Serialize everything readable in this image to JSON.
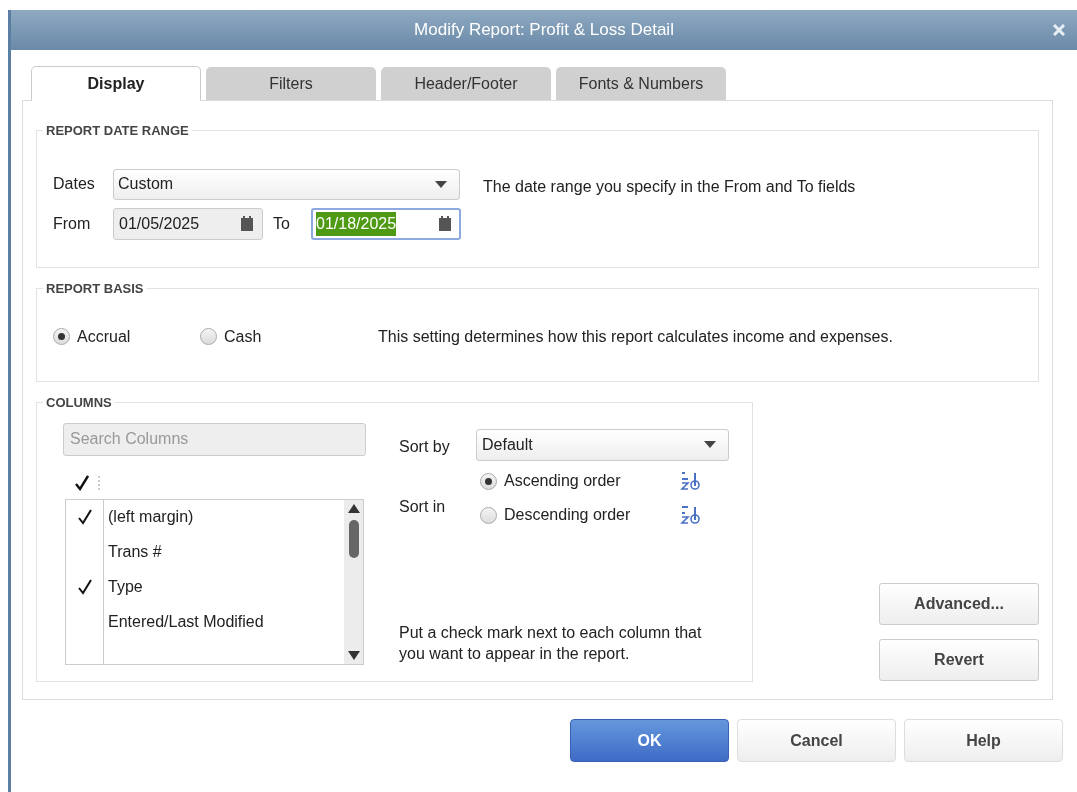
{
  "window": {
    "title": "Modify Report: Profit & Loss Detail"
  },
  "tabs": [
    {
      "label": "Display",
      "selected": true
    },
    {
      "label": "Filters",
      "selected": false
    },
    {
      "label": "Header/Footer",
      "selected": false
    },
    {
      "label": "Fonts & Numbers",
      "selected": false
    }
  ],
  "date_range": {
    "section_title": "REPORT DATE RANGE",
    "dates_label": "Dates",
    "dates_value": "Custom",
    "from_label": "From",
    "from_value": "01/05/2025",
    "to_label": "To",
    "to_value": "01/18/2025",
    "to_text_selected": true,
    "description": "The date range you specify in the From and To fields"
  },
  "report_basis": {
    "section_title": "REPORT BASIS",
    "options": [
      {
        "label": "Accrual",
        "selected": true
      },
      {
        "label": "Cash",
        "selected": false
      }
    ],
    "description": "This setting determines how this report calculates income and expenses."
  },
  "columns": {
    "section_title": "COLUMNS",
    "search_placeholder": "Search Columns",
    "items": [
      {
        "label": "(left margin)",
        "checked": true
      },
      {
        "label": "Trans #",
        "checked": false
      },
      {
        "label": "Type",
        "checked": true
      },
      {
        "label": "Entered/Last Modified",
        "checked": false
      }
    ],
    "sort_by_label": "Sort by",
    "sort_by_value": "Default",
    "sort_in_label": "Sort in",
    "sort_options": [
      {
        "label": "Ascending order",
        "kind": "ascending",
        "selected": true
      },
      {
        "label": "Descending order",
        "kind": "descending",
        "selected": false
      }
    ],
    "hint": "Put a check mark next to each column that you want to appear in the report."
  },
  "side_buttons": [
    "Advanced...",
    "Revert"
  ],
  "buttons": [
    {
      "label": "OK",
      "kind": "primary"
    },
    {
      "label": "Cancel",
      "kind": "default"
    },
    {
      "label": "Help",
      "kind": "default"
    }
  ]
}
